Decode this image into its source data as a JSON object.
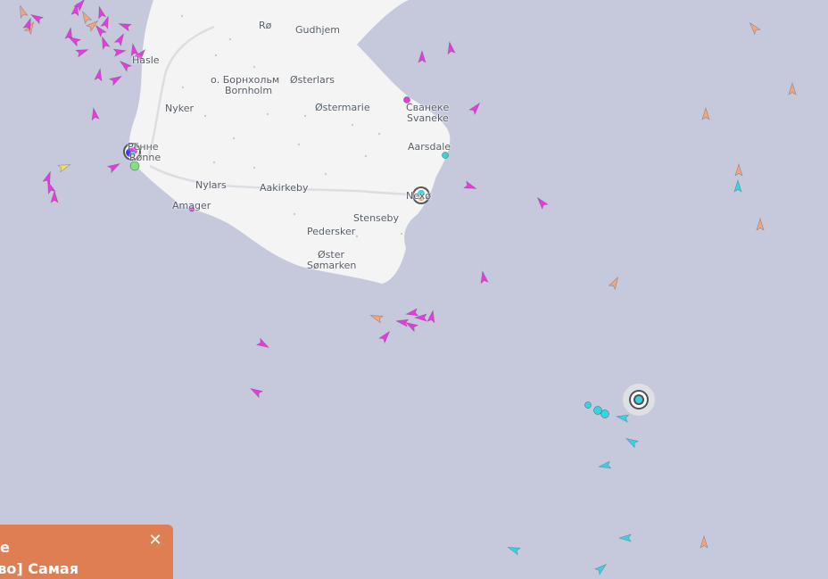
{
  "map": {
    "places": {
      "ro": "Rø",
      "gudhjem": "Gudhjem",
      "hasle": "Hasle",
      "bornholm_ru": "о. Борнхольм",
      "bornholm": "Bornholm",
      "osterlars": "Østerlars",
      "nyker": "Nyker",
      "ostermarie": "Østermarie",
      "svaneke_ru": "Сванеке",
      "svaneke": "Svaneke",
      "aarsdale": "Aarsdale",
      "ronne_ru": "Рённе",
      "ronne": "Rønne",
      "nylars": "Nylars",
      "aakirkeby": "Aakirkeby",
      "nexo": "Nexø",
      "amager": "Amager",
      "stenseby": "Stenseby",
      "pedersker": "Pedersker",
      "oster": "Øster",
      "somarken": "Sømarken"
    },
    "colors": {
      "sea": "#c5c9db",
      "land": "#f4f4f5",
      "road": "#dcdde2",
      "passenger": "#e83ae0",
      "cargo": "#f2a77a",
      "tanker": "#33d6e0",
      "fishing": "#f2e14a",
      "highlight": "#e0e0e4"
    },
    "vessel_icon": "vessel-arrow-icon",
    "port_icon": "port-marker-icon",
    "location_icon": "target-location-icon"
  },
  "promo": {
    "line1": "ное",
    "line2": "тво] Самая",
    "close_label": "✕",
    "close_icon": "close-icon"
  }
}
